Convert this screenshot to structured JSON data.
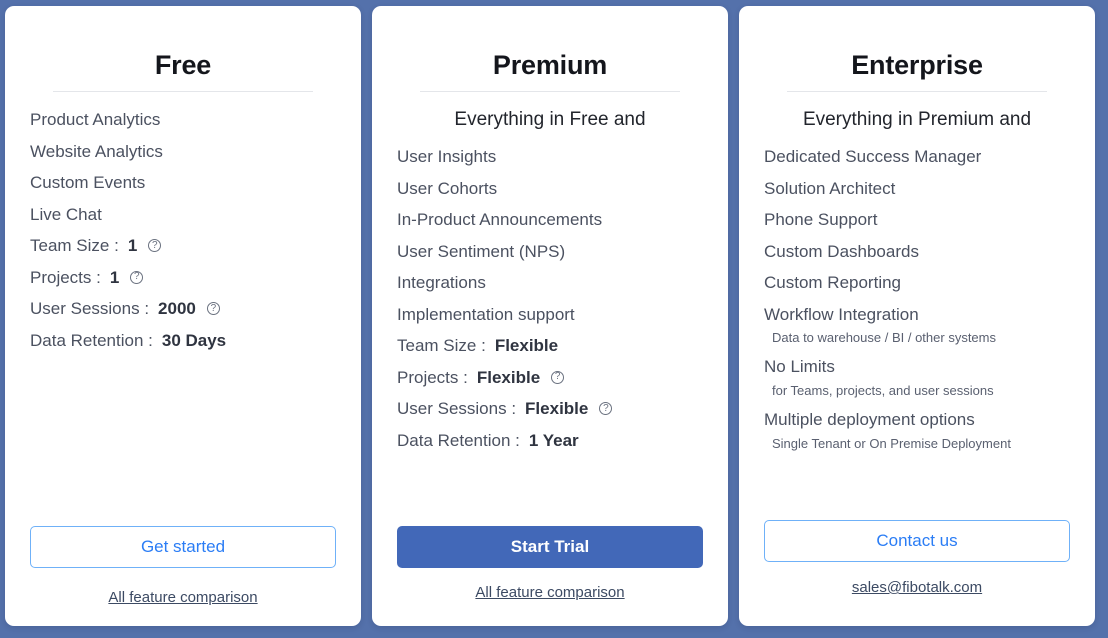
{
  "theme": {
    "page_background": "#5471ab",
    "card_background": "#ffffff",
    "accent_blue": "#4268b8",
    "outline_button_border": "#6fb1f8",
    "outline_button_text": "#2b7df5",
    "link_color": "#3c4a63",
    "feature_text": "#4b5160"
  },
  "plans": [
    {
      "id": "free",
      "title": "Free",
      "subtitle": "",
      "features": [
        {
          "label": "Product Analytics",
          "value": "",
          "help": false
        },
        {
          "label": "Website Analytics",
          "value": "",
          "help": false
        },
        {
          "label": "Custom Events",
          "value": "",
          "help": false
        },
        {
          "label": "Live Chat",
          "value": "",
          "help": false
        },
        {
          "label": "Team Size :",
          "value": "1",
          "help": true
        },
        {
          "label": "Projects :",
          "value": "1",
          "help": true
        },
        {
          "label": "User Sessions :",
          "value": "2000",
          "help": true
        },
        {
          "label": "Data Retention :",
          "value": "30 Days",
          "help": false
        }
      ],
      "cta": {
        "label": "Get started",
        "style": "outline",
        "icon": "none"
      },
      "footer_link": "All feature comparison"
    },
    {
      "id": "premium",
      "title": "Premium",
      "subtitle": "Everything in Free and",
      "features": [
        {
          "label": "User Insights",
          "value": "",
          "help": false
        },
        {
          "label": "User Cohorts",
          "value": "",
          "help": false
        },
        {
          "label": "In-Product Announcements",
          "value": "",
          "help": false
        },
        {
          "label": "User Sentiment (NPS)",
          "value": "",
          "help": false
        },
        {
          "label": "Integrations",
          "value": "",
          "help": false
        },
        {
          "label": "Implementation support",
          "value": "",
          "help": false
        },
        {
          "label": "Team Size :",
          "value": "Flexible",
          "help": false
        },
        {
          "label": "Projects :",
          "value": "Flexible",
          "help": true
        },
        {
          "label": "User Sessions :",
          "value": "Flexible",
          "help": true
        },
        {
          "label": "Data Retention :",
          "value": "1 Year",
          "help": false
        }
      ],
      "cta": {
        "label": "Start Trial",
        "style": "solid",
        "icon": "none"
      },
      "footer_link": "All feature comparison"
    },
    {
      "id": "enterprise",
      "title": "Enterprise",
      "subtitle": "Everything in Premium and",
      "features": [
        {
          "label": "Dedicated Success Manager",
          "value": "",
          "help": false
        },
        {
          "label": "Solution Architect",
          "value": "",
          "help": false
        },
        {
          "label": "Phone Support",
          "value": "",
          "help": false
        },
        {
          "label": "Custom Dashboards",
          "value": "",
          "help": false
        },
        {
          "label": "Custom Reporting",
          "value": "",
          "help": false
        },
        {
          "label": "Workflow Integration",
          "value": "",
          "help": false,
          "sub": "Data to warehouse / BI / other systems"
        },
        {
          "label": "No Limits",
          "value": "",
          "help": false,
          "sub": "for Teams, projects, and user sessions"
        },
        {
          "label": "Multiple deployment options",
          "value": "",
          "help": false,
          "sub": "Single Tenant or On Premise Deployment"
        }
      ],
      "cta": {
        "label": "Contact us",
        "style": "outline",
        "icon": "none"
      },
      "footer_link": "sales@fibotalk.com"
    }
  ]
}
